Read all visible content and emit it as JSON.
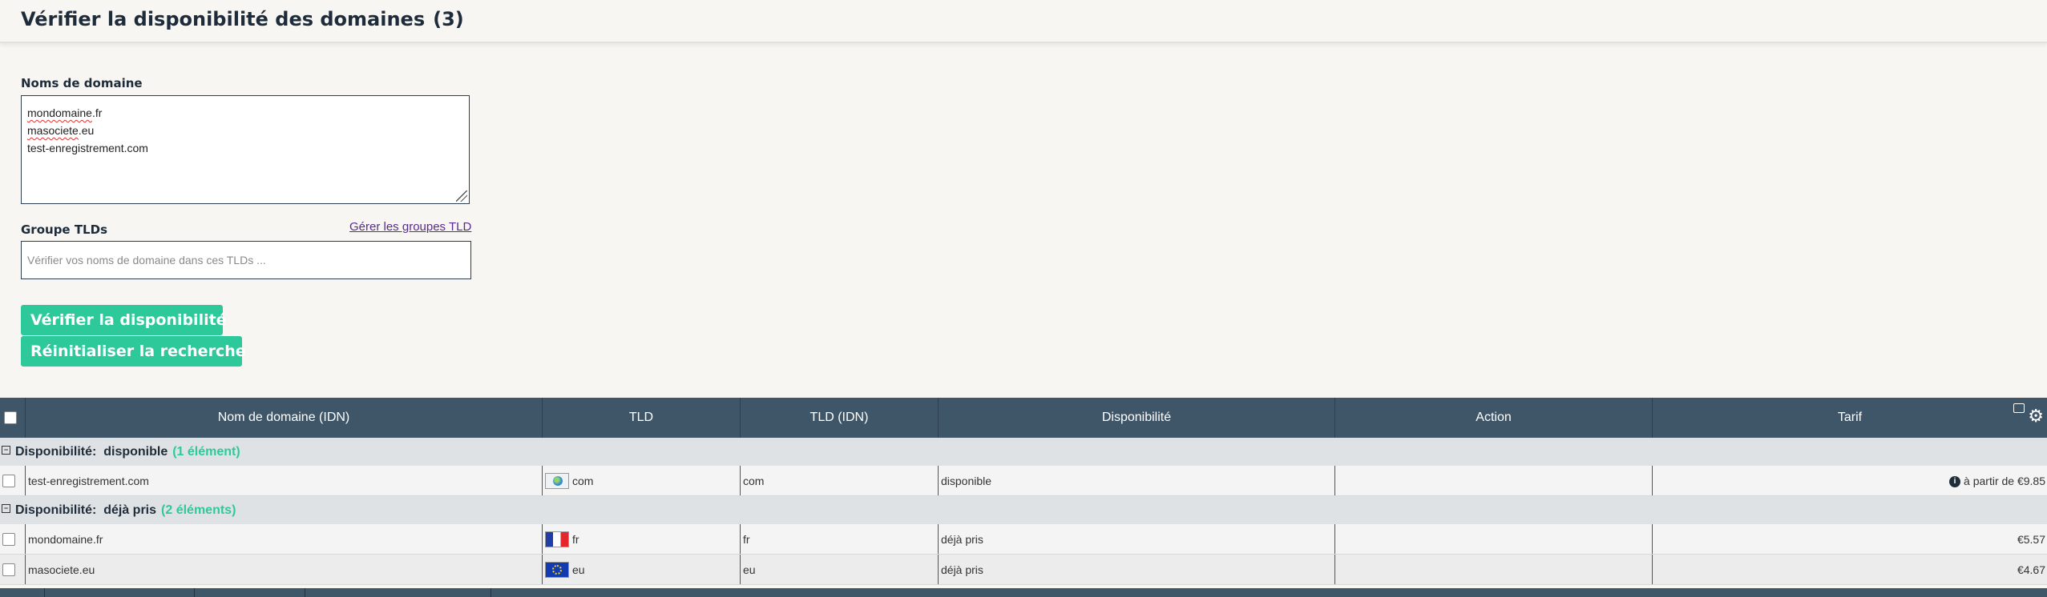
{
  "page": {
    "title": "Vérifier la disponibilité des domaines",
    "title_count": "(3)"
  },
  "form": {
    "domains_label": "Noms de domaine",
    "domains": [
      {
        "name": "mondomaine",
        "ext": ".fr"
      },
      {
        "name": "masociete",
        "ext": ".eu"
      },
      {
        "name": "test-enregistrement.com",
        "ext": ""
      }
    ],
    "tld_group_label": "Groupe TLDs",
    "manage_groups_link": "Gérer les groupes TLD",
    "tld_placeholder": "Vérifier vos noms de domaine dans ces TLDs ...",
    "check_button": "Vérifier la disponibilité",
    "reset_button": "Réinitialiser la recherche"
  },
  "table": {
    "columns": [
      "Nom de domaine (IDN)",
      "TLD",
      "TLD (IDN)",
      "Disponibilité",
      "Action",
      "Tarif"
    ],
    "groups": [
      {
        "prefix": "Disponibilité:",
        "value": "disponible",
        "count": "(1 élément)",
        "rows": [
          {
            "domain": "test-enregistrement.com",
            "tld": "com",
            "tld_idn": "com",
            "availability": "disponible",
            "action": "",
            "price": "à partir de €9.85",
            "flag": "globe-icon"
          }
        ]
      },
      {
        "prefix": "Disponibilité:",
        "value": "déjà pris",
        "count": "(2 éléments)",
        "rows": [
          {
            "domain": "mondomaine.fr",
            "tld": "fr",
            "tld_idn": "fr",
            "availability": "déjà pris",
            "action": "",
            "price": "€5.57",
            "flag": "flag-fr-icon"
          },
          {
            "domain": "masociete.eu",
            "tld": "eu",
            "tld_idn": "eu",
            "availability": "déjà pris",
            "action": "",
            "price": "€4.67",
            "flag": "flag-eu-icon"
          }
        ]
      }
    ]
  },
  "icons": {
    "settings": "gear-icon",
    "info": "info-icon",
    "row_menu": "hamburger-icon"
  },
  "colors": {
    "accent": "#2ec99a",
    "header_bg": "#3f5669",
    "link": "#5a2b8e"
  }
}
